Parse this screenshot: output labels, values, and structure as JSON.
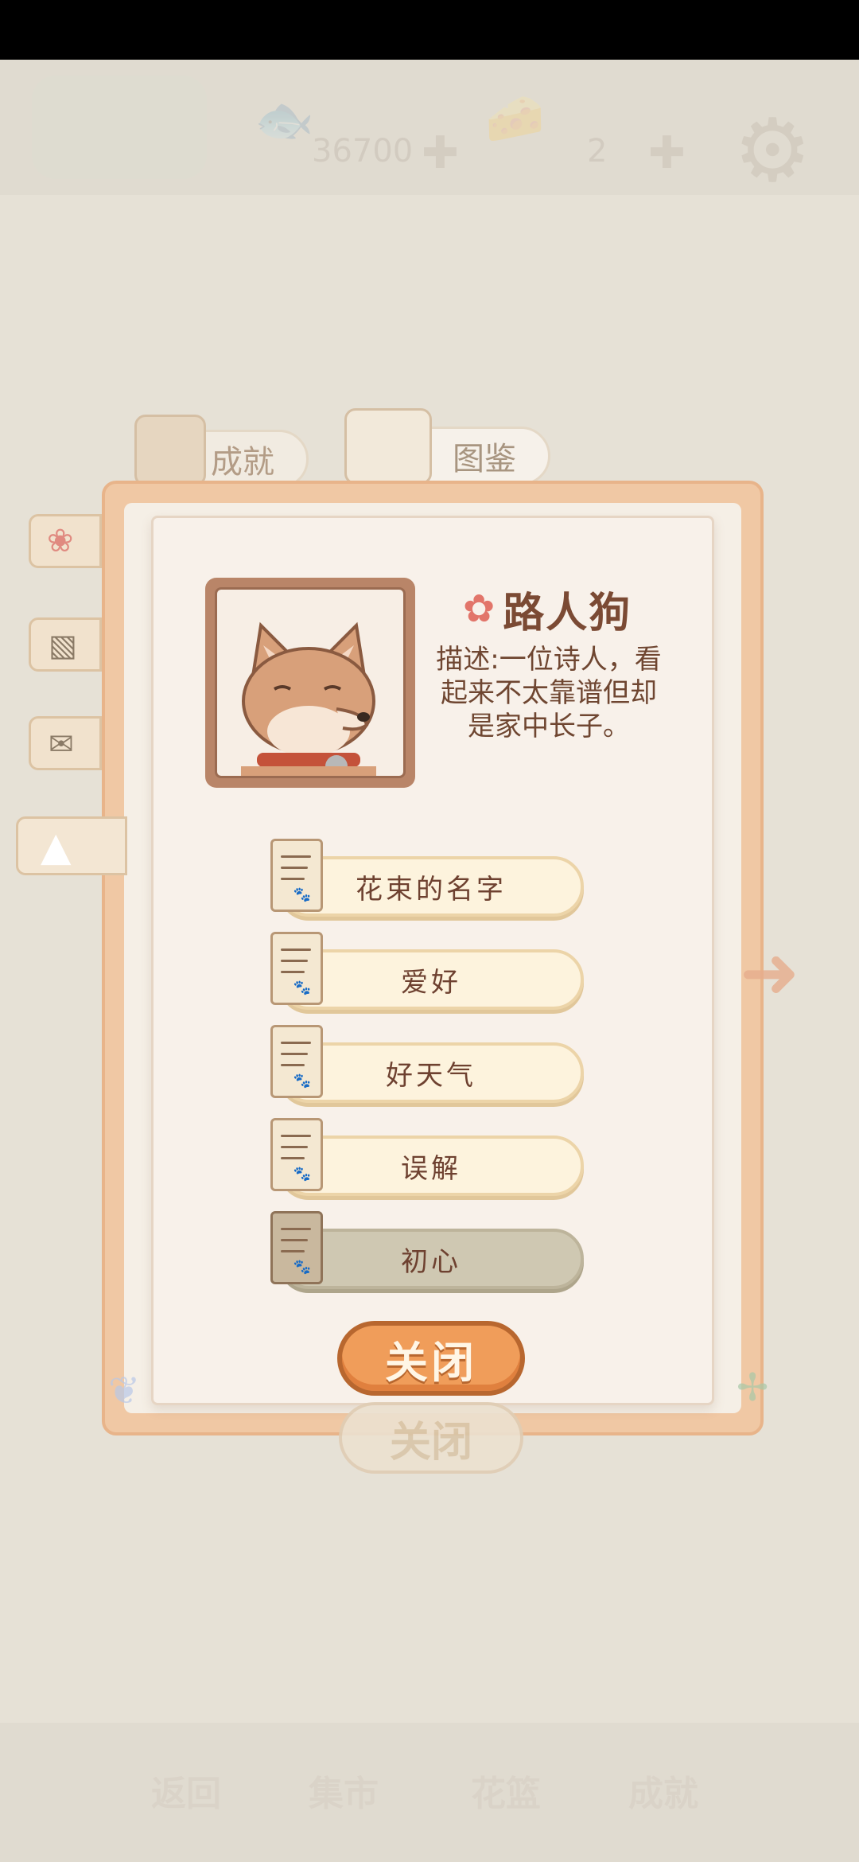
{
  "top_bar": {
    "fish_count": "36700",
    "cheese_count": "2"
  },
  "tabs": {
    "achievements": "成就",
    "collection": "图鉴"
  },
  "character": {
    "name": "路人狗",
    "description": "描述:一位诗人，看起来不太靠谱但却是家中长子。"
  },
  "story_items": [
    {
      "label": "花束的名字",
      "locked": false
    },
    {
      "label": "爱好",
      "locked": false
    },
    {
      "label": "好天气",
      "locked": false
    },
    {
      "label": "误解",
      "locked": false
    },
    {
      "label": "初心",
      "locked": true
    }
  ],
  "close_button": "关闭",
  "background_close_button": "关闭",
  "bottom_nav": [
    "返回",
    "集市",
    "花篮",
    "成就"
  ],
  "colors": {
    "close_button": "#f09d5a",
    "frame": "#f0c8a4",
    "paper": "#f8f1ea",
    "text": "#7b4a34"
  }
}
